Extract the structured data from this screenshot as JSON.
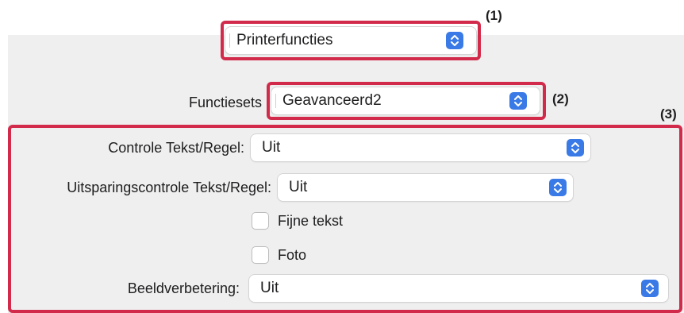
{
  "callouts": {
    "c1": "(1)",
    "c2": "(2)",
    "c3": "(3)"
  },
  "top_select": {
    "value": "Printerfuncties",
    "icon": "chevron-updown-icon"
  },
  "feature_sets": {
    "label": "Functiesets",
    "value": "Geavanceerd2"
  },
  "options": {
    "text_line_control": {
      "label": "Controle Tekst/Regel:",
      "value": "Uit"
    },
    "text_line_exclusion": {
      "label": "Uitsparingscontrole Tekst/Regel:",
      "value": "Uit"
    },
    "fine_text": {
      "label": "Fijne tekst",
      "checked": false
    },
    "photo": {
      "label": "Foto",
      "checked": false
    },
    "image_enhancement": {
      "label": "Beeldverbetering:",
      "value": "Uit"
    }
  },
  "colors": {
    "highlight": "#d22a4a",
    "accent": "#3a7ae6",
    "panel": "#efefef"
  }
}
